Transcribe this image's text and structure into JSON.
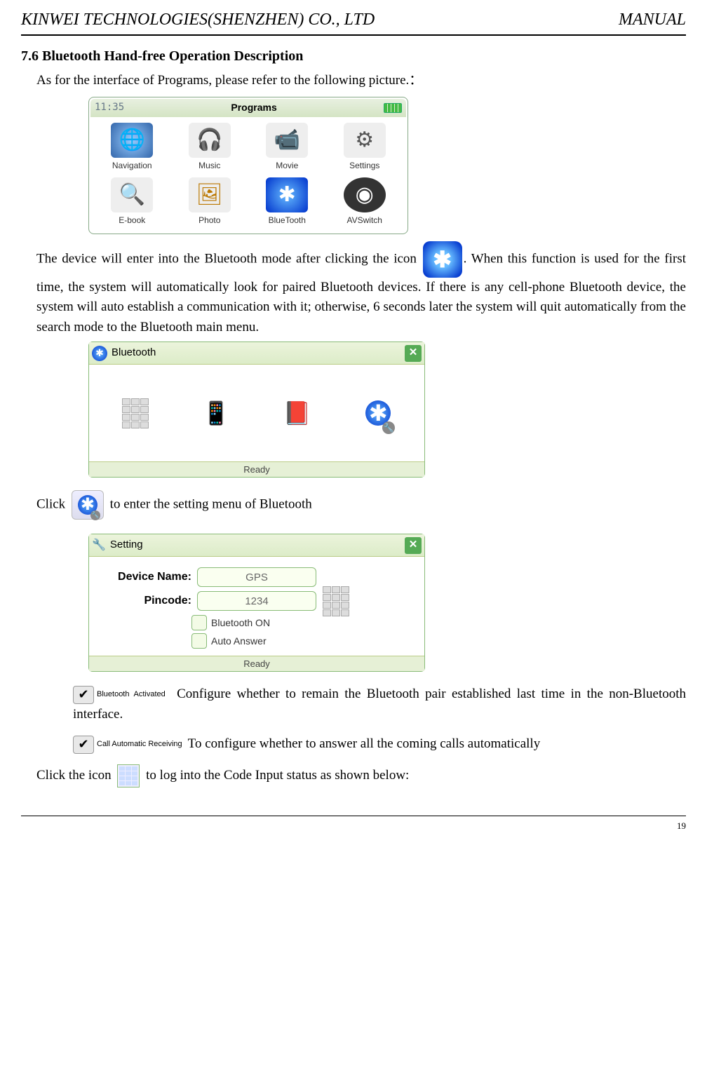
{
  "header": {
    "company": "KINWEI TECHNOLOGIES(SHENZHEN) CO., LTD",
    "doc": "MANUAL"
  },
  "section": {
    "num": "7.6",
    "title": "Bluetooth Hand-free Operation Description"
  },
  "intro": "As for the interface of Programs, please refer to the following picture.：",
  "programs_screen": {
    "time": "11:35",
    "title": "Programs",
    "apps": [
      {
        "label": "Navigation",
        "glyph": "🌐"
      },
      {
        "label": "Music",
        "glyph": "🎧"
      },
      {
        "label": "Movie",
        "glyph": "📹"
      },
      {
        "label": "Settings",
        "glyph": "⚙"
      },
      {
        "label": "E-book",
        "glyph": "🔍"
      },
      {
        "label": "Photo",
        "glyph": "🖼"
      },
      {
        "label": "BlueTooth",
        "glyph": "✱"
      },
      {
        "label": "AVSwitch",
        "glyph": "◉"
      }
    ]
  },
  "para1a": "The device will enter into the Bluetooth mode after clicking the icon",
  "para1b": ". When this function is used for the first time, the system will automatically look for paired Bluetooth devices. If there is any cell-phone Bluetooth device, the system will auto establish a communication with it; otherwise, 6 seconds later the system will quit automatically from the search mode to the Bluetooth main menu.",
  "bt_glyph": "✱",
  "bt_window": {
    "title": "Bluetooth",
    "close": "✕",
    "status": "Ready"
  },
  "click_a": "Click",
  "click_b": "to enter the setting menu of Bluetooth",
  "setting_window": {
    "title": "Setting",
    "device_label": "Device Name:",
    "device_value": "GPS",
    "pin_label": "Pincode:",
    "pin_value": "1234",
    "bt_on": "Bluetooth ON",
    "auto_answer": "Auto Answer",
    "status": "Ready"
  },
  "opt1_label": "Bluetooth Activated",
  "opt1_text": "Configure whether to remain the Bluetooth pair established last time in the non-Bluetooth interface.",
  "opt2_label": "Call Automatic Receiving",
  "opt2_text": "To configure whether to answer all the coming calls automatically",
  "click2a": "Click the icon",
  "click2b": "to log into the Code Input status as shown below:",
  "page_no": "19"
}
